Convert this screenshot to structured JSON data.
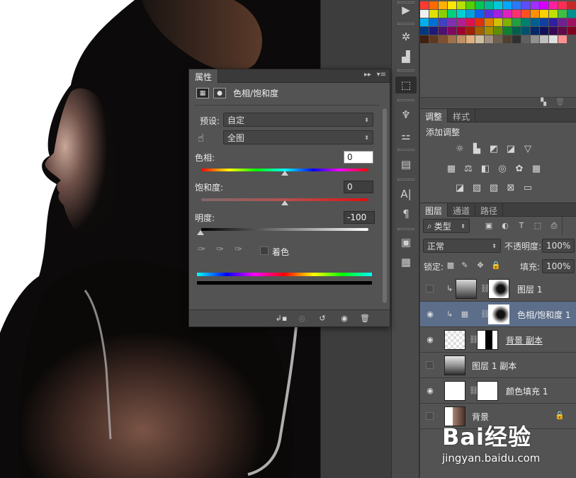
{
  "properties_panel": {
    "tab_label": "属性",
    "title": "色相/饱和度",
    "preset_label": "预设:",
    "preset_value": "自定",
    "range_value": "全图",
    "hue_label": "色相:",
    "hue_value": "0",
    "saturation_label": "饱和度:",
    "saturation_value": "0",
    "lightness_label": "明度:",
    "lightness_value": "-100",
    "colorize_label": "着色"
  },
  "adjustments_panel": {
    "tabs": [
      "调整",
      "样式"
    ],
    "title": "添加调整"
  },
  "layers_panel": {
    "tabs": [
      "图层",
      "通道",
      "路径"
    ],
    "filter_label": "类型",
    "blend_mode": "正常",
    "opacity_label": "不透明度:",
    "opacity_value": "100%",
    "lock_label": "锁定:",
    "fill_label": "填充:",
    "fill_value": "100%",
    "layers": [
      {
        "name": "图层 1",
        "visible": false,
        "clipped": true
      },
      {
        "name": "色相/饱和度 1",
        "visible": true,
        "clipped": true,
        "selected": true
      },
      {
        "name": "背景 副本",
        "visible": true
      },
      {
        "name": "图层 1 副本",
        "visible": false
      },
      {
        "name": "颜色填充 1",
        "visible": true
      },
      {
        "name": "背景",
        "visible": false,
        "locked": true
      }
    ]
  },
  "watermark": {
    "logo": "Bai经验",
    "url": "jingyan.baidu.com"
  },
  "swatch_colors": [
    [
      "#ff3b30",
      "#ff6a00",
      "#ffb000",
      "#ffe600",
      "#b8e000",
      "#52d000",
      "#00c853",
      "#00b894",
      "#00c8d8",
      "#00a8ff",
      "#2979ff",
      "#5c4dff",
      "#9b30ff",
      "#d500f9",
      "#ff1fa0",
      "#ff2d55",
      "#c62828"
    ],
    [
      "#f0f0f0",
      "#e0e000",
      "#8ad000",
      "#00d080",
      "#00d0d0",
      "#00a0e0",
      "#1060f0",
      "#5a30e0",
      "#a020e0",
      "#e020c0",
      "#ff3070",
      "#ff5020",
      "#ff9000",
      "#ffd000",
      "#c0e000",
      "#40c040",
      "#009090"
    ],
    [
      "#00b0f0",
      "#0070d0",
      "#4040c0",
      "#8030b0",
      "#b02090",
      "#e01050",
      "#e03010",
      "#e08000",
      "#d0c000",
      "#80b000",
      "#20a040",
      "#008070",
      "#006090",
      "#1040a0",
      "#3020a0",
      "#702090",
      "#a01060"
    ],
    [
      "#003880",
      "#201878",
      "#501070",
      "#800860",
      "#a00030",
      "#a02000",
      "#a06000",
      "#a09000",
      "#609000",
      "#108030",
      "#006050",
      "#005070",
      "#002868",
      "#101058",
      "#380858",
      "#600848",
      "#800020"
    ],
    [
      "#402010",
      "#603820",
      "#805030",
      "#a07048",
      "#c09060",
      "#e0b080",
      "#d0c0a0",
      "#a09080",
      "#706050",
      "#504030",
      "#303030",
      "#606060",
      "#909090",
      "#c0c0c0",
      "#e0e0e0",
      "#ff9090"
    ]
  ]
}
